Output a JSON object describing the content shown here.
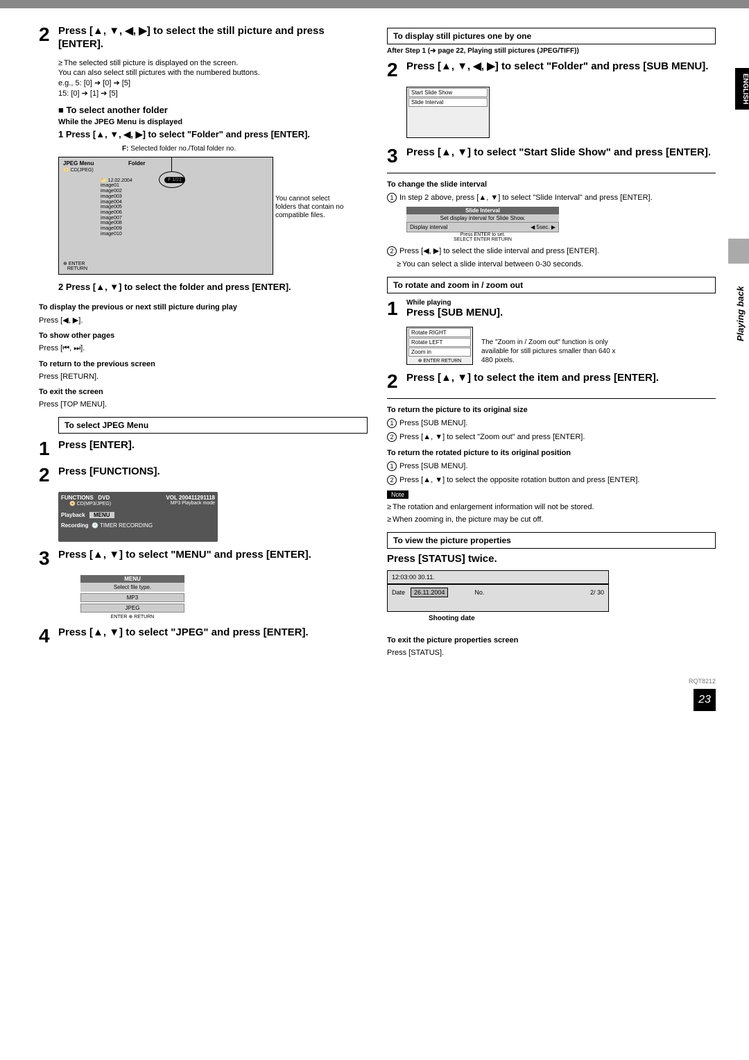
{
  "doc_id": "RQT8212",
  "page_number": "23",
  "side_tabs": {
    "english": "ENGLISH",
    "playback": "Playing back"
  },
  "left": {
    "step2_title": "Press [▲, ▼, ◀, ▶] to select the still picture and press [ENTER].",
    "step2_note1": "The selected still picture is displayed on the screen.",
    "step2_note2": "You can also select still pictures with the numbered buttons.",
    "step2_eg1": "e.g.,   5:  [0] ➔ [0]  ➔ [5]",
    "step2_eg2": "         15:  [0] ➔ [1]  ➔ [5]",
    "select_another_folder": "To select another folder",
    "while_jpeg_menu": "While the JPEG Menu is displayed",
    "sub1": "1  Press [▲, ▼, ◀, ▶] to select \"Folder\" and press [ENTER].",
    "f_label": "F: Selected folder no./Total folder no.",
    "jpeg_menu": {
      "title": "JPEG Menu",
      "folder_label": "Folder",
      "cd_label": "CD(JPEG)",
      "counter": "F 1/21",
      "date": "12.02.2004",
      "files": [
        "image01",
        "image002",
        "image003",
        "image004",
        "image005",
        "image006",
        "image007",
        "image008",
        "image009",
        "image010"
      ],
      "enter": "ENTER",
      "return": "RETURN"
    },
    "callout": "You cannot select folders that contain no compatible files.",
    "sub2": "2  Press [▲, ▼] to select the folder and press [ENTER].",
    "disp_prev_head": "To display the previous or next still picture during play",
    "disp_prev_text": "Press [◀, ▶].",
    "show_pages_head": "To show other pages",
    "show_pages_text": "Press [⏮, ⏭].",
    "return_head": "To return to the previous screen",
    "return_text": "Press [RETURN].",
    "exit_head": "To exit the screen",
    "exit_text": "Press [TOP MENU].",
    "select_jpeg_menu": "To select JPEG Menu",
    "step_enter": "Press [ENTER].",
    "step_functions": "Press [FUNCTIONS].",
    "functions_box": {
      "head": "FUNCTIONS",
      "dvd": "DVD",
      "vol": "VOL  200411291118",
      "cd": "CD(MP3/JPEG)",
      "mode": "MP3 Playback mode",
      "playback": "Playback",
      "menu": "MENU",
      "recording": "Recording",
      "timer": "TIMER RECORDING"
    },
    "step3_title": "Press [▲, ▼] to select \"MENU\" and press [ENTER].",
    "menu_popup": {
      "title": "MENU",
      "instr": "Select file type.",
      "opts": [
        "MP3",
        "JPEG"
      ],
      "enter": "ENTER",
      "return": "RETURN"
    },
    "step4_title": "Press [▲, ▼] to select \"JPEG\" and press [ENTER]."
  },
  "right": {
    "box_display_one": "To display still pictures one by one",
    "after_step1": "After Step 1 (➔ page 22, Playing still pictures (JPEG/TIFF))",
    "step2_title": "Press [▲, ▼, ◀, ▶] to select \"Folder\" and press [SUB MENU].",
    "popup_items": [
      "Start Slide Show",
      "Slide Interval"
    ],
    "step3_title": "Press [▲, ▼] to select \"Start Slide Show\" and press [ENTER].",
    "change_interval_head": "To change the slide interval",
    "change_interval_1": "In step 2 above, press [▲, ▼] to select \"Slide Interval\" and press [ENTER].",
    "interval_box": {
      "title": "Slide Interval",
      "caption": "Set display interval for Slide Show.",
      "label": "Display interval",
      "value": "5sec.",
      "press_enter": "Press ENTER to set.",
      "foot": "SELECT  ENTER  RETURN"
    },
    "change_interval_2": "Press [◀, ▶] to select the slide interval and press [ENTER].",
    "change_interval_bullet": "You can select a slide interval between 0-30 seconds.",
    "rotate_head": "To rotate and zoom in / zoom out",
    "while_playing": "While playing",
    "press_submenu": "Press [SUB MENU].",
    "rotate_menu": {
      "opts": [
        "Rotate RIGHT",
        "Rotate LEFT",
        "Zoom in"
      ],
      "foot": "ENTER  RETURN"
    },
    "rotate_note": "The \"Zoom in / Zoom out\" function is only available for still pictures smaller than 640 x 480 pixels.",
    "step2b_title": "Press [▲, ▼] to select the item and press [ENTER].",
    "orig_size_head": "To return the picture to its original size",
    "orig_size_1": "Press [SUB MENU].",
    "orig_size_2": "Press [▲, ▼] to select \"Zoom out\" and press [ENTER].",
    "orig_pos_head": "To return the rotated picture to its original position",
    "orig_pos_1": "Press [SUB MENU].",
    "orig_pos_2": "Press [▲, ▼] to select the opposite rotation button and press [ENTER].",
    "note_label": "Note",
    "note1": "The rotation and enlargement information will not be stored.",
    "note2": "When zooming in, the picture may be cut off.",
    "view_props_head": "To view the picture properties",
    "press_status": "Press [STATUS] twice.",
    "status_box": {
      "top": "12:03:00  30.11.",
      "date_label": "Date",
      "date": "26.11.2004",
      "no_label": "No.",
      "no": "2/ 30"
    },
    "shooting_date": "Shooting date",
    "exit_props_head": "To exit the picture properties screen",
    "exit_props_text": "Press [STATUS]."
  }
}
